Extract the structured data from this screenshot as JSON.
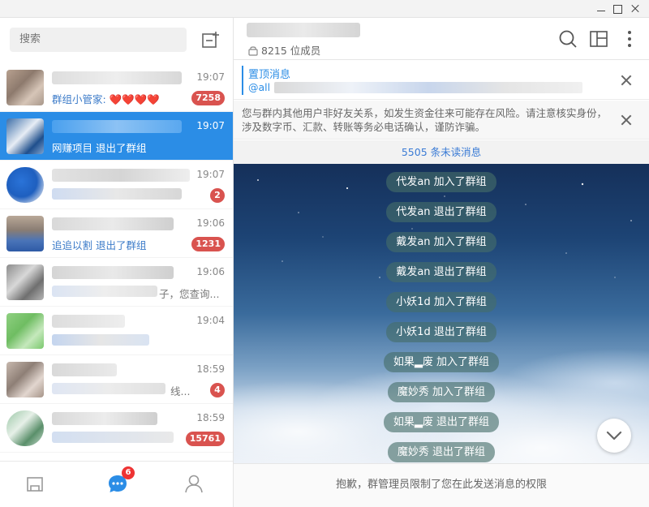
{
  "window": {
    "minimize": "—",
    "maximize": "□",
    "close": "✕"
  },
  "sidebar": {
    "search_placeholder": "搜索",
    "chats": [
      {
        "time": "19:07",
        "preview": "群组小管家: ❤️❤️❤️❤️",
        "badge": "7258"
      },
      {
        "time": "19:07",
        "preview": "网赚项目 退出了群组",
        "badge": ""
      },
      {
        "time": "19:07",
        "preview": "",
        "badge": "2"
      },
      {
        "time": "19:06",
        "preview": "追追以割 退出了群组",
        "badge": "1231"
      },
      {
        "time": "19:06",
        "preview": "子，您查询...",
        "badge": ""
      },
      {
        "time": "19:04",
        "preview": "",
        "badge": ""
      },
      {
        "time": "18:59",
        "preview": "线...",
        "badge": "4"
      },
      {
        "time": "18:59",
        "preview": "",
        "badge": "15761"
      }
    ],
    "nav": {
      "chats_badge": "6"
    }
  },
  "chat": {
    "members": "8215 位成员",
    "pinned": {
      "title": "置顶消息",
      "content_prefix": "@all"
    },
    "notice": "您与群内其他用户非好友关系，如发生资金往来可能存在风险。请注意核实身份，涉及数字币、汇款、转账等务必电话确认，谨防诈骗。",
    "unread": "5505 条未读消息",
    "system_messages": [
      "代发an 加入了群组",
      "代发an 退出了群组",
      "戴发an 加入了群组",
      "戴发an 退出了群组",
      "小妖1d 加入了群组",
      "小妖1d 退出了群组",
      "如果▂废 加入了群组",
      "魔妙秀 加入了群组",
      "如果▂废 退出了群组",
      "魔妙秀 退出了群组"
    ],
    "footer": "抱歉，群管理员限制了您在此发送消息的权限"
  },
  "colors": {
    "accent": "#2b8de6",
    "badge": "#d9534f",
    "nav_badge": "#e33333"
  }
}
